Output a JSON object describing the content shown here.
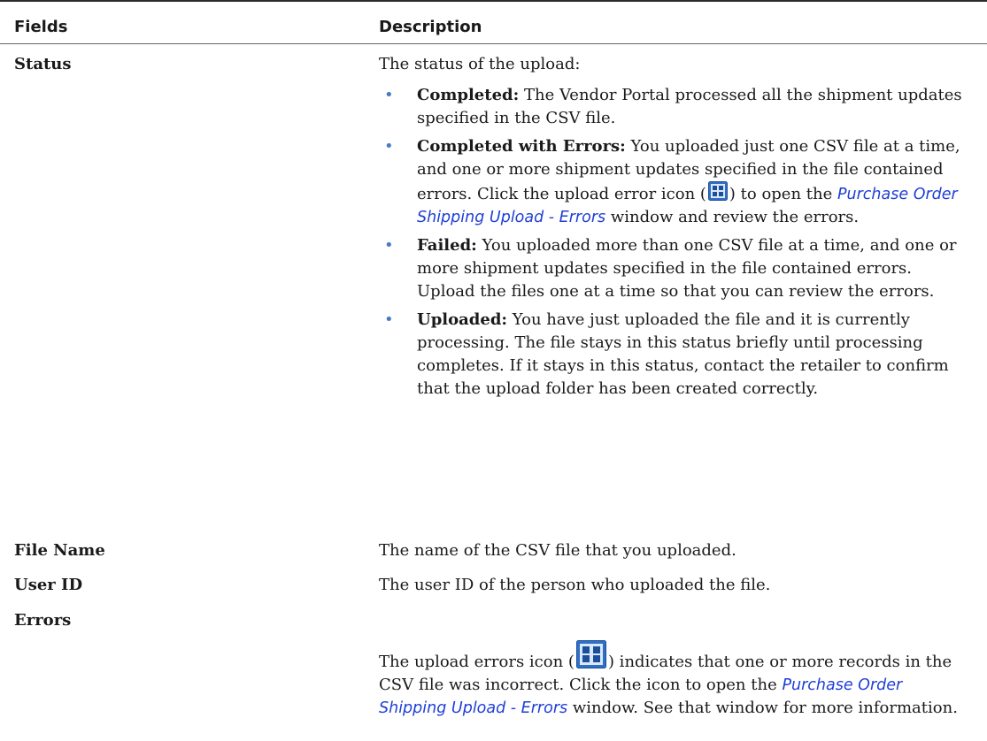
{
  "header": {
    "fields": "Fields",
    "description": "Description"
  },
  "rows": [
    {
      "field": "Status",
      "intro": "The status of the upload:",
      "items": [
        {
          "term": "Completed:",
          "text": " The Vendor Portal processed all the shipment updates specified in the CSV file."
        },
        {
          "term": "Completed with Errors:",
          "text_before": " You uploaded just one CSV file at a time, and one or more shipment updates specified in the file contained errors. Click the upload error icon (",
          "text_mid": ") to open the ",
          "link": "Purchase Order Shipping Upload - Errors",
          "text_after": " window and review the errors."
        },
        {
          "term": "Failed:",
          "text": " You uploaded more than one CSV file at a time, and one or more shipment updates specified in the file contained errors. Upload the files one at a time so that you can review the errors."
        },
        {
          "term": "Uploaded:",
          "text": " You have just uploaded the file and it is currently processing. The file stays in this status briefly until processing completes. If it stays in this status, contact the retailer to confirm that the upload folder has been created correctly."
        }
      ]
    },
    {
      "field": "File Name",
      "description": "The name of the CSV file that you uploaded."
    },
    {
      "field": "User ID",
      "description": "The user ID of the person who uploaded the file."
    },
    {
      "field": "Errors",
      "text_before": "The upload errors icon (",
      "text_mid": ") indicates that one or more records in the CSV file was incorrect. Click the icon to open the ",
      "link": "Purchase Order Shipping Upload - Errors",
      "text_after": " window. See that window for more information."
    }
  ],
  "icons": {
    "upload_error": "upload-error-icon",
    "bullet": "bullet"
  },
  "colors": {
    "link": "#1f3fd6",
    "bullet": "#4a7bc2",
    "icon_blue": "#2f6fc4"
  }
}
